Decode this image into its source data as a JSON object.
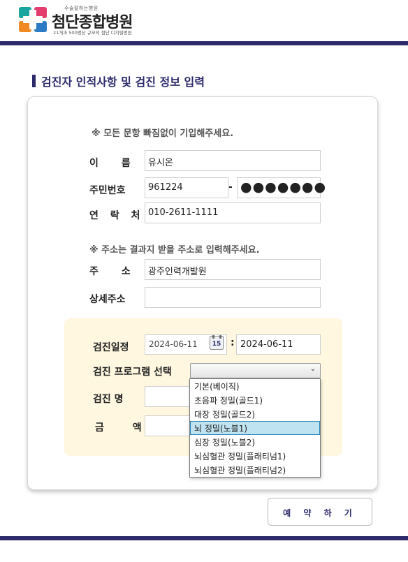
{
  "header": {
    "logo_small": "수술잘하는병원",
    "logo_main": "첨단종합병원",
    "logo_sub": "21개과 500병상 규모의 첨단 디지털병원",
    "brand_color": "#2c2a6b"
  },
  "section_title": "검진자 인적사항 및 검진 정보 입력",
  "form": {
    "notice1": "※ 모든 문항 빠짐없이 기입해주세요.",
    "name_label": "이 름",
    "name_value": "유시온",
    "rrn_label": "주민번호",
    "rrn_front": "961224",
    "rrn_dash": "-",
    "rrn_back": "●●●●●●●",
    "phone_label": "연 락 처",
    "phone_value": "010-2611-1111",
    "notice2": "※ 주소는 결과지 받을 주소로 입력해주세요.",
    "address_label": "주 소",
    "address_value": "광주인력개발원",
    "detail_address_label": "상세주소",
    "detail_address_value": ""
  },
  "exam": {
    "date_label": "검진일정",
    "date_from": "2024-06-11",
    "calendar_icon_text": "15",
    "colon": ":",
    "date_to": "2024-06-11",
    "program_label": "검진 프로그램 선택",
    "program_selected": "",
    "exam_name_label": "검진 명",
    "price_label": "금 액",
    "program_options": [
      "기본(베이직)",
      "초음파 정밀(골드1)",
      "대장 정밀(골드2)",
      "뇌 정밀(노블1)",
      "심장 정밀(노블2)",
      "뇌심혈관 정밀(플래티넘1)",
      "뇌심혈관 정밀(플래티넘2)"
    ],
    "highlighted_option_index": 3
  },
  "reserve_button": "예 약 하 기"
}
